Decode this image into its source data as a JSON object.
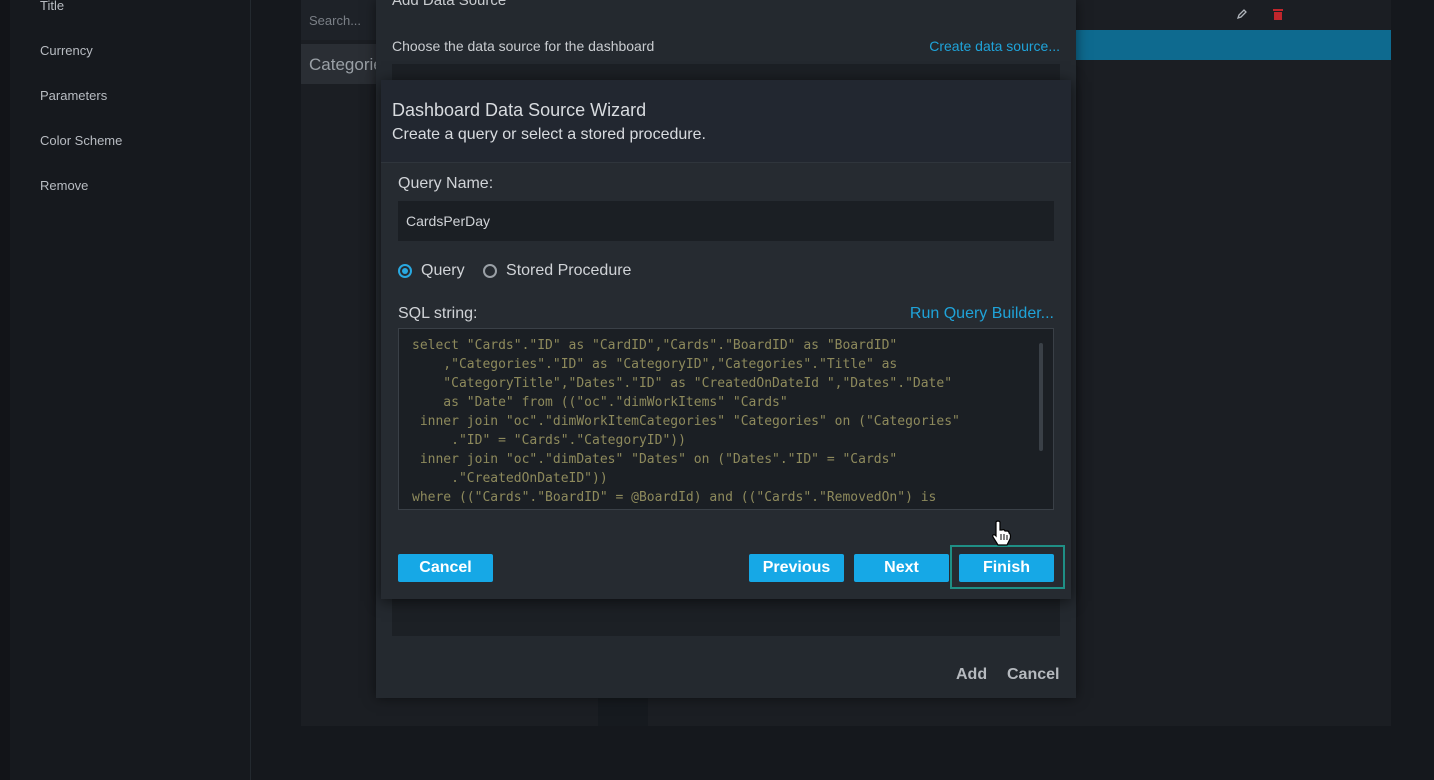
{
  "sidebar": {
    "items": [
      {
        "label": "Title"
      },
      {
        "label": "Currency"
      },
      {
        "label": "Parameters"
      },
      {
        "label": "Color Scheme"
      },
      {
        "label": "Remove"
      }
    ]
  },
  "background": {
    "search_placeholder": "Search...",
    "category_header": "Categories",
    "edit_icon": "pencil-icon",
    "delete_icon": "trash-icon"
  },
  "add_dialog": {
    "title": "Add Data Source",
    "subtitle": "Choose the data source for the dashboard",
    "create_link": "Create data source...",
    "add_label": "Add",
    "cancel_label": "Cancel"
  },
  "wizard": {
    "title": "Dashboard Data Source Wizard",
    "subtitle": "Create a query or select a stored procedure.",
    "query_name_label": "Query Name:",
    "query_name_value": "CardsPerDay",
    "radio_query": "Query",
    "radio_stored_procedure": "Stored Procedure",
    "selected_option": "Query",
    "sql_label": "SQL string:",
    "query_builder_link": "Run Query Builder...",
    "sql_text": "select \"Cards\".\"ID\" as \"CardID\",\"Cards\".\"BoardID\" as \"BoardID\"\n    ,\"Categories\".\"ID\" as \"CategoryID\",\"Categories\".\"Title\" as\n    \"CategoryTitle\",\"Dates\".\"ID\" as \"CreatedOnDateId \",\"Dates\".\"Date\"\n    as \"Date\" from ((\"oc\".\"dimWorkItems\" \"Cards\"\n inner join \"oc\".\"dimWorkItemCategories\" \"Categories\" on (\"Categories\"\n     .\"ID\" = \"Cards\".\"CategoryID\"))\n inner join \"oc\".\"dimDates\" \"Dates\" on (\"Dates\".\"ID\" = \"Cards\"\n     .\"CreatedOnDateID\"))\nwhere ((\"Cards\".\"BoardID\" = @BoardId) and ((\"Cards\".\"RemovedOn\") is",
    "buttons": {
      "cancel": "Cancel",
      "previous": "Previous",
      "next": "Next",
      "finish": "Finish"
    }
  },
  "colors": {
    "accent": "#16a8e6",
    "link": "#1fa3d9",
    "selected_row": "#0e6a8f",
    "focus_outline": "#1f8f85",
    "delete": "#c0262c"
  },
  "cursor": "hand-pointer-icon"
}
